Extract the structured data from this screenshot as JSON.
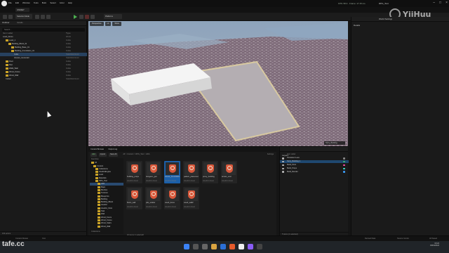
{
  "titlebar": {
    "menu": [
      "File",
      "Edit",
      "Window",
      "Tools",
      "Build",
      "Select",
      "Actor",
      "Help"
    ],
    "project_tab": "UNREP",
    "window_title": "RPG_Test"
  },
  "toolbar": {
    "mode": "Selection Mode",
    "platforms": "Platforms",
    "stats": "FPS: 58.3  ·  Frame: 17.15 ms"
  },
  "watermark_top": "YiiHuu",
  "watermark_bottom": "tafe.cc",
  "outliner": {
    "title": "Outliner",
    "tab2": "Details",
    "search_placeholder": "Search...",
    "col_label": "Item Label",
    "col_type": "Type",
    "rows": [
      {
        "label": "Level_Demo",
        "type": "World",
        "indent": 1,
        "folder": false,
        "sel": false
      },
      {
        "label": "Level_1",
        "type": "Folder",
        "indent": 2,
        "folder": true,
        "sel": false
      },
      {
        "label": "Building_Block_01",
        "type": "Folder",
        "indent": 3,
        "folder": true,
        "sel": false
      },
      {
        "label": "Building_Base_01",
        "type": "Folder",
        "indent": 4,
        "folder": true,
        "sel": false
      },
      {
        "label": "Building_Foundation_01",
        "type": "Folder",
        "indent": 4,
        "folder": true,
        "sel": false
      },
      {
        "label": "Cube",
        "type": "StaticMeshActor",
        "indent": 5,
        "folder": false,
        "sel": true
      },
      {
        "label": "Houses_Generator",
        "type": "StaticMeshActor",
        "indent": 5,
        "folder": false,
        "sel": false
      },
      {
        "label": "Floor",
        "type": "Folder",
        "indent": 2,
        "folder": true,
        "sel": false
      },
      {
        "label": "Roof",
        "type": "Folder",
        "indent": 2,
        "folder": true,
        "sel": false
      },
      {
        "label": "Walls_Wall",
        "type": "Folder",
        "indent": 2,
        "folder": true,
        "sel": false
      },
      {
        "label": "Wood_Frame",
        "type": "Folder",
        "indent": 2,
        "folder": true,
        "sel": false
      },
      {
        "label": "Wood_Wall",
        "type": "Folder",
        "indent": 2,
        "folder": true,
        "sel": false
      },
      {
        "label": "Cube2",
        "type": "StaticMeshActor",
        "indent": 2,
        "folder": false,
        "sel": false
      }
    ],
    "footer": "104 actors"
  },
  "viewport": {
    "buttons": [
      "Perspective",
      "Lit",
      "Show"
    ],
    "status": "Story_Building"
  },
  "details": {
    "title": "Details",
    "world_settings": "World Settings"
  },
  "content_browser": {
    "tabs": [
      "Content Browser",
      "Output Log"
    ],
    "add": "Add",
    "import": "Import",
    "save_all": "Save All",
    "breadcrumb": "All > Content > RPG_Test > HDA",
    "settings": "Settings",
    "favorites": "Favorites",
    "collections": "Collections",
    "sources": [
      {
        "label": "All",
        "indent": 0,
        "sel": false
      },
      {
        "label": "Content",
        "indent": 1,
        "sel": false
      },
      {
        "label": "Collections",
        "indent": 2,
        "sel": false
      },
      {
        "label": "HoudiniEngine",
        "indent": 2,
        "sel": false
      },
      {
        "label": "Level",
        "indent": 2,
        "sel": false
      },
      {
        "label": "Materials",
        "indent": 2,
        "sel": false
      },
      {
        "label": "RPG_Test",
        "indent": 2,
        "sel": false
      },
      {
        "label": "HDA",
        "indent": 3,
        "sel": true
      },
      {
        "label": "Maps",
        "indent": 3,
        "sel": false
      },
      {
        "label": "Meshes",
        "indent": 3,
        "sel": false
      },
      {
        "label": "Textures",
        "indent": 3,
        "sel": false
      },
      {
        "label": "Blueprints",
        "indent": 3,
        "sel": false
      },
      {
        "label": "Building",
        "indent": 3,
        "sel": false
      },
      {
        "label": "Building_Block",
        "indent": 3,
        "sel": false
      },
      {
        "label": "Houdini",
        "indent": 3,
        "sel": false
      },
      {
        "label": "Houdini_Floor",
        "indent": 3,
        "sel": false
      },
      {
        "label": "Stair",
        "indent": 3,
        "sel": false
      },
      {
        "label": "Wall",
        "indent": 3,
        "sel": false
      },
      {
        "label": "Wood_Fence",
        "indent": 3,
        "sel": false
      },
      {
        "label": "Wood_Frame",
        "indent": 3,
        "sel": false
      },
      {
        "label": "Wood_Stairs",
        "indent": 3,
        "sel": false
      },
      {
        "label": "Wood_Wall",
        "indent": 3,
        "sel": false
      }
    ],
    "assets": [
      {
        "name": "building_props",
        "type": "Houdini Asset",
        "sel": false
      },
      {
        "name": "dungeon_gen",
        "type": "Houdini Asset",
        "sel": false
      },
      {
        "name": "House_Foundation",
        "type": "Houdini Asset",
        "sel": true
      },
      {
        "name": "pattern_placement",
        "type": "Houdini Asset",
        "sel": false
      },
      {
        "name": "proxy_building",
        "type": "Houdini Asset",
        "sel": false
      },
      {
        "name": "terrain_scat",
        "type": "Houdini Asset",
        "sel": false
      },
      {
        "name": "floors_wall",
        "type": "Houdini Asset",
        "sel": false
      },
      {
        "name": "pile_scatter",
        "type": "Houdini Asset",
        "sel": false
      },
      {
        "name": "wood_fence",
        "type": "Houdini Asset",
        "sel": false
      },
      {
        "name": "wood_wall2",
        "type": "Houdini Asset",
        "sel": false
      }
    ],
    "count": "10 items (1 selected)"
  },
  "layers": {
    "title": "Layers",
    "col_label": "Item Label",
    "rows": [
      {
        "label": "Persistent Level",
        "sel": false,
        "color": "#888888"
      },
      {
        "label": "Story_Building 1",
        "sel": true,
        "color": "#3cb371"
      },
      {
        "label": "Build_Floor",
        "sel": false,
        "color": "#ff4fb0"
      },
      {
        "label": "Build_Props",
        "sel": false,
        "color": "#40e0d0"
      },
      {
        "label": "Build_Render",
        "sel": false,
        "color": "#3aa0ff"
      }
    ],
    "footer": "5 items (1 selected)"
  },
  "statusbar": {
    "left": "Content Drawer",
    "cmd": "Cmd",
    "right_a": "Derived Data",
    "right_b": "Source Control",
    "right_c": "All Saved"
  },
  "taskbar": {
    "time": "03:24",
    "date": "03/04/2024"
  }
}
